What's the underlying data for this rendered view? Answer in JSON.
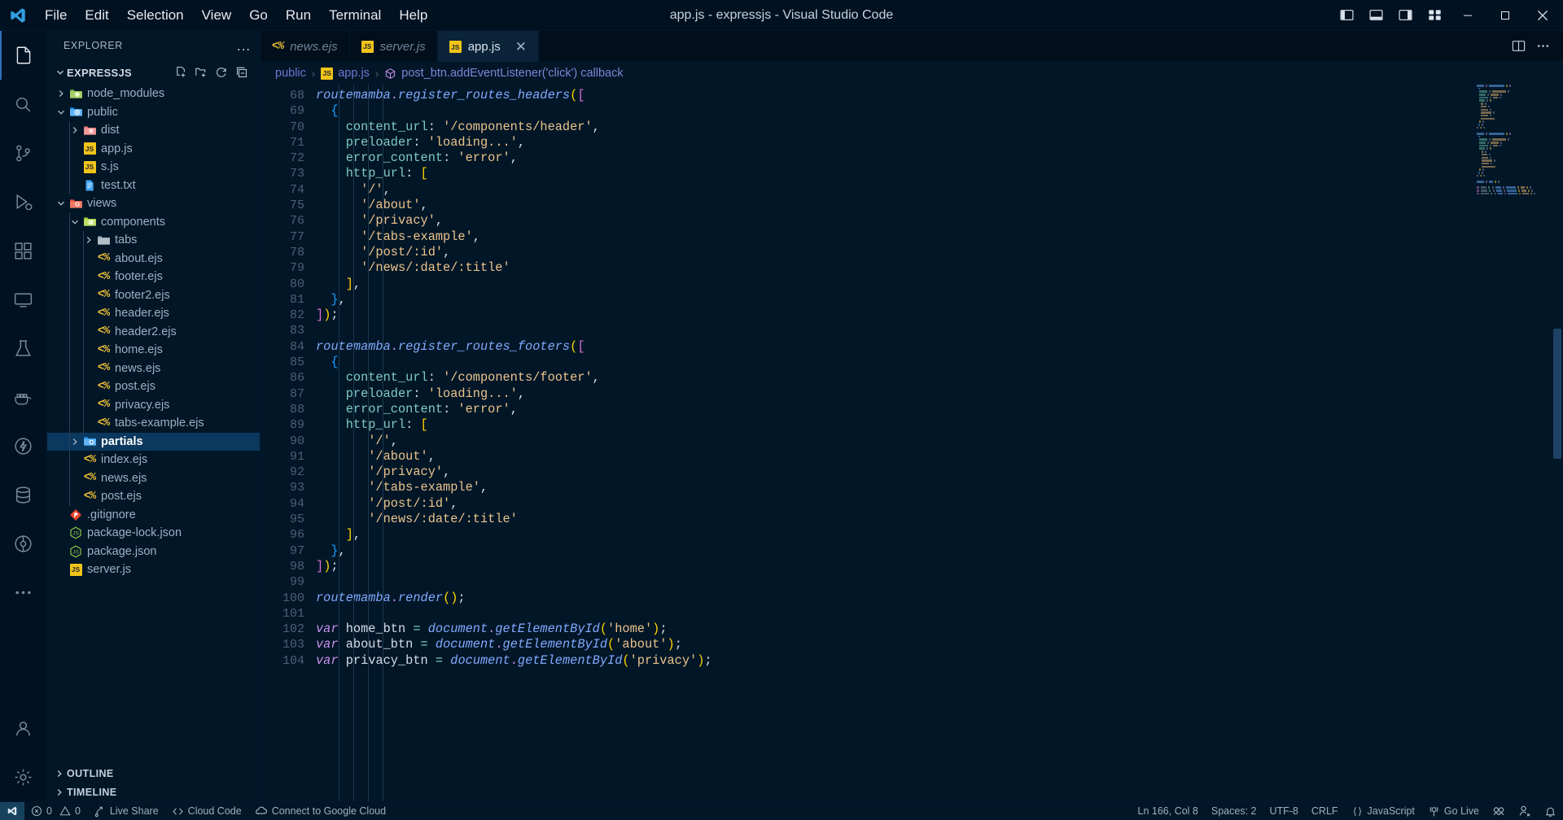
{
  "window": {
    "title": "app.js - expressjs - Visual Studio Code",
    "logo": "vscode-logo"
  },
  "menubar": {
    "items": [
      {
        "label": "File"
      },
      {
        "label": "Edit"
      },
      {
        "label": "Selection"
      },
      {
        "label": "View"
      },
      {
        "label": "Go"
      },
      {
        "label": "Run"
      },
      {
        "label": "Terminal"
      },
      {
        "label": "Help"
      }
    ]
  },
  "titlebar_controls": {
    "layout_buttons": [
      "toggle-primary-sidebar",
      "toggle-panel",
      "toggle-secondary-sidebar",
      "customize-layout"
    ],
    "minimize": "─",
    "maximize": "❐",
    "close": "✕"
  },
  "activitybar": {
    "items": [
      {
        "name": "explorer",
        "active": true
      },
      {
        "name": "search",
        "active": false
      },
      {
        "name": "source-control",
        "active": false
      },
      {
        "name": "run-and-debug",
        "active": false
      },
      {
        "name": "extensions",
        "active": false
      },
      {
        "name": "remote-explorer",
        "active": false
      },
      {
        "name": "testing",
        "active": false
      },
      {
        "name": "docker",
        "active": false
      },
      {
        "name": "thunder-client",
        "active": false
      },
      {
        "name": "database",
        "active": false
      },
      {
        "name": "gitlens",
        "active": false
      },
      {
        "name": "more-views",
        "active": false
      }
    ],
    "bottom": [
      {
        "name": "accounts"
      },
      {
        "name": "manage-settings"
      }
    ]
  },
  "sidebar": {
    "title": "EXPLORER",
    "more_actions": "…",
    "project": {
      "name": "EXPRESSJS",
      "actions": [
        "new-file",
        "new-folder",
        "refresh-explorer",
        "collapse-folders"
      ]
    },
    "tree": [
      {
        "label": "node_modules",
        "type": "folder",
        "indent": 1,
        "expanded": false,
        "icon": "folder-node"
      },
      {
        "label": "public",
        "type": "folder",
        "indent": 1,
        "expanded": true,
        "icon": "folder-public"
      },
      {
        "label": "dist",
        "type": "folder",
        "indent": 2,
        "expanded": false,
        "icon": "folder-dist"
      },
      {
        "label": "app.js",
        "type": "js",
        "indent": 2
      },
      {
        "label": "s.js",
        "type": "js",
        "indent": 2
      },
      {
        "label": "test.txt",
        "type": "txt",
        "indent": 2
      },
      {
        "label": "views",
        "type": "folder",
        "indent": 1,
        "expanded": true,
        "icon": "folder-views"
      },
      {
        "label": "components",
        "type": "folder",
        "indent": 2,
        "expanded": true,
        "icon": "folder-components"
      },
      {
        "label": "tabs",
        "type": "folder",
        "indent": 3,
        "expanded": false,
        "icon": "folder-plain"
      },
      {
        "label": "about.ejs",
        "type": "ejs",
        "indent": 3
      },
      {
        "label": "footer.ejs",
        "type": "ejs",
        "indent": 3
      },
      {
        "label": "footer2.ejs",
        "type": "ejs",
        "indent": 3
      },
      {
        "label": "header.ejs",
        "type": "ejs",
        "indent": 3
      },
      {
        "label": "header2.ejs",
        "type": "ejs",
        "indent": 3
      },
      {
        "label": "home.ejs",
        "type": "ejs",
        "indent": 3
      },
      {
        "label": "news.ejs",
        "type": "ejs",
        "indent": 3
      },
      {
        "label": "post.ejs",
        "type": "ejs",
        "indent": 3
      },
      {
        "label": "privacy.ejs",
        "type": "ejs",
        "indent": 3
      },
      {
        "label": "tabs-example.ejs",
        "type": "ejs",
        "indent": 3
      },
      {
        "label": "partials",
        "type": "folder",
        "indent": 2,
        "expanded": false,
        "icon": "folder-partials",
        "selected": true
      },
      {
        "label": "index.ejs",
        "type": "ejs",
        "indent": 2
      },
      {
        "label": "news.ejs",
        "type": "ejs",
        "indent": 2
      },
      {
        "label": "post.ejs",
        "type": "ejs",
        "indent": 2
      },
      {
        "label": ".gitignore",
        "type": "git",
        "indent": 1
      },
      {
        "label": "package-lock.json",
        "type": "npm",
        "indent": 1
      },
      {
        "label": "package.json",
        "type": "npm",
        "indent": 1
      },
      {
        "label": "server.js",
        "type": "js",
        "indent": 1
      }
    ],
    "panels": [
      {
        "label": "OUTLINE",
        "expanded": false
      },
      {
        "label": "TIMELINE",
        "expanded": false
      }
    ]
  },
  "tabs": [
    {
      "label": "news.ejs",
      "icon": "ejs",
      "active": false,
      "preview": true
    },
    {
      "label": "server.js",
      "icon": "js",
      "active": false,
      "preview": false
    },
    {
      "label": "app.js",
      "icon": "js",
      "active": true,
      "preview": false,
      "close": "✕"
    }
  ],
  "editor_actions": [
    "split-editor-right",
    "more-editor-actions"
  ],
  "breadcrumb": {
    "segments": [
      {
        "label": "public",
        "icon": "folder"
      },
      {
        "label": "app.js",
        "icon": "js"
      },
      {
        "label": "post_btn.addEventListener('click') callback",
        "icon": "symbol-method"
      }
    ],
    "separator": "›"
  },
  "code": {
    "first_line": 68,
    "lines": [
      {
        "n": 68,
        "tokens": [
          {
            "t": "var",
            "v": "routemamba"
          },
          {
            "t": "punc",
            "v": "."
          },
          {
            "t": "fn",
            "v": "register_routes_headers"
          },
          {
            "t": "br1",
            "v": "("
          },
          {
            "t": "br2",
            "v": "["
          }
        ],
        "indent": 0
      },
      {
        "n": 69,
        "tokens": [
          {
            "t": "br3",
            "v": "  {"
          }
        ]
      },
      {
        "n": 70,
        "tokens": [
          {
            "t": "prop",
            "v": "    content_url"
          },
          {
            "t": "plain",
            "v": ": "
          },
          {
            "t": "str",
            "v": "'/components/header'"
          },
          {
            "t": "plain",
            "v": ","
          }
        ]
      },
      {
        "n": 71,
        "tokens": [
          {
            "t": "prop",
            "v": "    preloader"
          },
          {
            "t": "plain",
            "v": ": "
          },
          {
            "t": "str",
            "v": "'loading...'"
          },
          {
            "t": "plain",
            "v": ","
          }
        ]
      },
      {
        "n": 72,
        "tokens": [
          {
            "t": "prop",
            "v": "    error_content"
          },
          {
            "t": "plain",
            "v": ": "
          },
          {
            "t": "str",
            "v": "'error'"
          },
          {
            "t": "plain",
            "v": ","
          }
        ]
      },
      {
        "n": 73,
        "tokens": [
          {
            "t": "prop",
            "v": "    http_url"
          },
          {
            "t": "plain",
            "v": ": "
          },
          {
            "t": "br1",
            "v": "["
          }
        ]
      },
      {
        "n": 74,
        "tokens": [
          {
            "t": "str",
            "v": "      '/'"
          },
          {
            "t": "plain",
            "v": ","
          }
        ]
      },
      {
        "n": 75,
        "tokens": [
          {
            "t": "str",
            "v": "      '/about'"
          },
          {
            "t": "plain",
            "v": ","
          }
        ]
      },
      {
        "n": 76,
        "tokens": [
          {
            "t": "str",
            "v": "      '/privacy'"
          },
          {
            "t": "plain",
            "v": ","
          }
        ]
      },
      {
        "n": 77,
        "tokens": [
          {
            "t": "str",
            "v": "      '/tabs-example'"
          },
          {
            "t": "plain",
            "v": ","
          }
        ]
      },
      {
        "n": 78,
        "tokens": [
          {
            "t": "str",
            "v": "      '/post/:id'"
          },
          {
            "t": "plain",
            "v": ","
          }
        ]
      },
      {
        "n": 79,
        "tokens": [
          {
            "t": "str",
            "v": "      '/news/:date/:title'"
          }
        ]
      },
      {
        "n": 80,
        "tokens": [
          {
            "t": "br1",
            "v": "    ]"
          },
          {
            "t": "plain",
            "v": ","
          }
        ]
      },
      {
        "n": 81,
        "tokens": [
          {
            "t": "br3",
            "v": "  }"
          },
          {
            "t": "plain",
            "v": ","
          }
        ]
      },
      {
        "n": 82,
        "tokens": [
          {
            "t": "br2",
            "v": "]"
          },
          {
            "t": "br1",
            "v": ")"
          },
          {
            "t": "plain",
            "v": ";"
          }
        ]
      },
      {
        "n": 83,
        "tokens": []
      },
      {
        "n": 84,
        "tokens": [
          {
            "t": "var",
            "v": "routemamba"
          },
          {
            "t": "punc",
            "v": "."
          },
          {
            "t": "fn",
            "v": "register_routes_footers"
          },
          {
            "t": "br1",
            "v": "("
          },
          {
            "t": "br2",
            "v": "["
          }
        ]
      },
      {
        "n": 85,
        "tokens": [
          {
            "t": "br3",
            "v": "  {"
          }
        ]
      },
      {
        "n": 86,
        "tokens": [
          {
            "t": "prop",
            "v": "    content_url"
          },
          {
            "t": "plain",
            "v": ": "
          },
          {
            "t": "str",
            "v": "'/components/footer'"
          },
          {
            "t": "plain",
            "v": ","
          }
        ]
      },
      {
        "n": 87,
        "tokens": [
          {
            "t": "prop",
            "v": "    preloader"
          },
          {
            "t": "plain",
            "v": ": "
          },
          {
            "t": "str",
            "v": "'loading...'"
          },
          {
            "t": "plain",
            "v": ","
          }
        ]
      },
      {
        "n": 88,
        "tokens": [
          {
            "t": "prop",
            "v": "    error_content"
          },
          {
            "t": "plain",
            "v": ": "
          },
          {
            "t": "str",
            "v": "'error'"
          },
          {
            "t": "plain",
            "v": ","
          }
        ]
      },
      {
        "n": 89,
        "tokens": [
          {
            "t": "prop",
            "v": "    http_url"
          },
          {
            "t": "plain",
            "v": ": "
          },
          {
            "t": "br1",
            "v": "["
          }
        ]
      },
      {
        "n": 90,
        "tokens": [
          {
            "t": "str",
            "v": "       '/'"
          },
          {
            "t": "plain",
            "v": ","
          }
        ]
      },
      {
        "n": 91,
        "tokens": [
          {
            "t": "str",
            "v": "       '/about'"
          },
          {
            "t": "plain",
            "v": ","
          }
        ]
      },
      {
        "n": 92,
        "tokens": [
          {
            "t": "str",
            "v": "       '/privacy'"
          },
          {
            "t": "plain",
            "v": ","
          }
        ]
      },
      {
        "n": 93,
        "tokens": [
          {
            "t": "str",
            "v": "       '/tabs-example'"
          },
          {
            "t": "plain",
            "v": ","
          }
        ]
      },
      {
        "n": 94,
        "tokens": [
          {
            "t": "str",
            "v": "       '/post/:id'"
          },
          {
            "t": "plain",
            "v": ","
          }
        ]
      },
      {
        "n": 95,
        "tokens": [
          {
            "t": "str",
            "v": "       '/news/:date/:title'"
          }
        ]
      },
      {
        "n": 96,
        "tokens": [
          {
            "t": "br1",
            "v": "    ]"
          },
          {
            "t": "plain",
            "v": ","
          }
        ]
      },
      {
        "n": 97,
        "tokens": [
          {
            "t": "br3",
            "v": "  }"
          },
          {
            "t": "plain",
            "v": ","
          }
        ]
      },
      {
        "n": 98,
        "tokens": [
          {
            "t": "br2",
            "v": "]"
          },
          {
            "t": "br1",
            "v": ")"
          },
          {
            "t": "plain",
            "v": ";"
          }
        ]
      },
      {
        "n": 99,
        "tokens": []
      },
      {
        "n": 100,
        "tokens": [
          {
            "t": "var",
            "v": "routemamba"
          },
          {
            "t": "punc",
            "v": "."
          },
          {
            "t": "fn",
            "v": "render"
          },
          {
            "t": "br1",
            "v": "()"
          },
          {
            "t": "plain",
            "v": ";"
          }
        ]
      },
      {
        "n": 101,
        "tokens": []
      },
      {
        "n": 102,
        "tokens": [
          {
            "t": "kw",
            "v": "var"
          },
          {
            "t": "plain",
            "v": " home_btn "
          },
          {
            "t": "op",
            "v": "="
          },
          {
            "t": "plain",
            "v": " "
          },
          {
            "t": "var",
            "v": "document"
          },
          {
            "t": "punc",
            "v": "."
          },
          {
            "t": "fn",
            "v": "getElementById"
          },
          {
            "t": "br1",
            "v": "("
          },
          {
            "t": "str",
            "v": "'home'"
          },
          {
            "t": "br1",
            "v": ")"
          },
          {
            "t": "plain",
            "v": ";"
          }
        ]
      },
      {
        "n": 103,
        "tokens": [
          {
            "t": "kw",
            "v": "var"
          },
          {
            "t": "plain",
            "v": " about_btn "
          },
          {
            "t": "op",
            "v": "="
          },
          {
            "t": "plain",
            "v": " "
          },
          {
            "t": "var",
            "v": "document"
          },
          {
            "t": "punc",
            "v": "."
          },
          {
            "t": "fn",
            "v": "getElementById"
          },
          {
            "t": "br1",
            "v": "("
          },
          {
            "t": "str",
            "v": "'about'"
          },
          {
            "t": "br1",
            "v": ")"
          },
          {
            "t": "plain",
            "v": ";"
          }
        ]
      },
      {
        "n": 104,
        "tokens": [
          {
            "t": "kw",
            "v": "var"
          },
          {
            "t": "plain",
            "v": " privacy_btn "
          },
          {
            "t": "op",
            "v": "="
          },
          {
            "t": "plain",
            "v": " "
          },
          {
            "t": "var",
            "v": "document"
          },
          {
            "t": "punc",
            "v": "."
          },
          {
            "t": "fn",
            "v": "getElementById"
          },
          {
            "t": "br1",
            "v": "("
          },
          {
            "t": "str",
            "v": "'privacy'"
          },
          {
            "t": "br1",
            "v": ")"
          },
          {
            "t": "plain",
            "v": ";"
          }
        ]
      }
    ]
  },
  "statusbar": {
    "remote_icon": "remote-window-icon",
    "left": [
      {
        "name": "problems",
        "icon": "error-circle",
        "label": "0",
        "icon2": "warning-triangle",
        "label2": "0"
      },
      {
        "name": "live-share",
        "icon": "live-share-icon",
        "label": "Live Share"
      },
      {
        "name": "cloud-code",
        "icon": "code-brackets-icon",
        "label": "Cloud Code"
      },
      {
        "name": "connect-google-cloud",
        "icon": "cloud-icon",
        "label": "Connect to Google Cloud"
      }
    ],
    "right": [
      {
        "name": "cursor-position",
        "label": "Ln 166, Col 8"
      },
      {
        "name": "indentation",
        "label": "Spaces: 2"
      },
      {
        "name": "encoding",
        "label": "UTF-8"
      },
      {
        "name": "eol",
        "label": "CRLF"
      },
      {
        "name": "language-mode",
        "icon": "braces-icon",
        "label": "JavaScript"
      },
      {
        "name": "go-live",
        "icon": "broadcast-icon",
        "label": "Go Live"
      },
      {
        "name": "gitlens-toggle",
        "icon": "gitlens-icon",
        "label": ""
      },
      {
        "name": "remote-share",
        "icon": "person-add-icon",
        "label": ""
      },
      {
        "name": "notifications",
        "icon": "bell-icon",
        "label": ""
      }
    ]
  },
  "colors": {
    "bg": "#011627",
    "titlebar": "#001122",
    "accent": "#2f6fbd",
    "selection": "#0b385f",
    "string": "#ecc48d",
    "property": "#80cbc4",
    "function": "#82aaff",
    "keyword": "#c792ea"
  }
}
